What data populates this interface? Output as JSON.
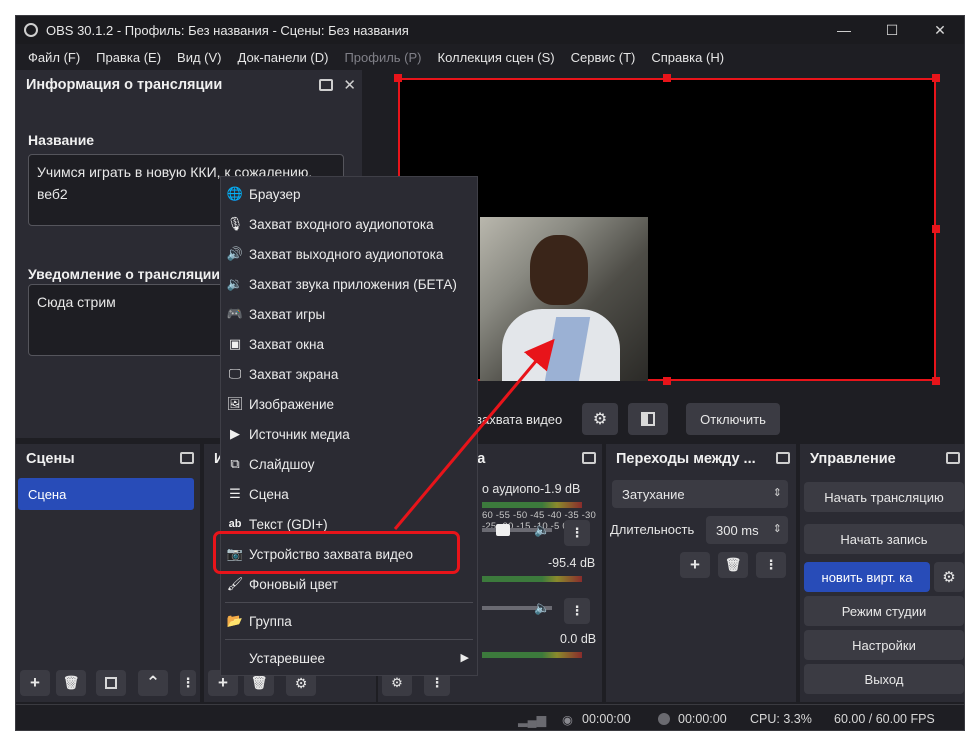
{
  "window": {
    "title": "OBS 30.1.2 - Профиль: Без названия - Сцены: Без названия",
    "minimize": "—",
    "maximize": "☐",
    "close": "✕"
  },
  "menu": [
    {
      "label": "Файл (F)",
      "enabled": true
    },
    {
      "label": "Правка (E)",
      "enabled": true
    },
    {
      "label": "Вид (V)",
      "enabled": true
    },
    {
      "label": "Док-панели (D)",
      "enabled": true
    },
    {
      "label": "Профиль (P)",
      "enabled": false
    },
    {
      "label": "Коллекция сцен (S)",
      "enabled": true
    },
    {
      "label": "Сервис (T)",
      "enabled": true
    },
    {
      "label": "Справка (H)",
      "enabled": true
    }
  ],
  "info_dock": {
    "title": "Информация о трансляции",
    "name_label": "Название",
    "name_value": "Учимся играть в новую ККИ, к сожалению, веб2",
    "notify_label": "Уведомление о трансляции",
    "notify_value": "Сюда стрим"
  },
  "preview_toolbar": {
    "source_name": "захвата видео",
    "disconnect": "Отключить"
  },
  "scenes": {
    "title": "Сцены",
    "items": [
      "Сцена"
    ]
  },
  "sources": {
    "title_partial": "И"
  },
  "mixer": {
    "title_partial": "ка",
    "channel1_name": "о аудиопо-1.9 dB",
    "channel2_db": "-95.4 dB",
    "channel3_db": "0.0 dB",
    "scale": "60 -55 -50 -45 -40 -35 -30 -25 -20 -15 -10 -5 0"
  },
  "transitions": {
    "title": "Переходы между ...",
    "selected": "Затухание",
    "duration_label": "Длительность",
    "duration_value": "300 ms"
  },
  "controls": {
    "title": "Управление",
    "start_stream": "Начать трансляцию",
    "start_record": "Начать запись",
    "virtual_cam": "новить вирт. ка",
    "studio_mode": "Режим студии",
    "settings": "Настройки",
    "exit": "Выход"
  },
  "status": {
    "stream_time": "00:00:00",
    "rec_time": "00:00:00",
    "cpu": "CPU: 3.3%",
    "fps": "60.00 / 60.00 FPS"
  },
  "context_menu": {
    "items": [
      {
        "label": "Браузер",
        "icon": "globe-icon"
      },
      {
        "label": "Захват входного аудиопотока",
        "icon": "microphone-icon"
      },
      {
        "label": "Захват выходного аудиопотока",
        "icon": "speaker-icon"
      },
      {
        "label": "Захват звука приложения (БЕТА)",
        "icon": "app-audio-icon"
      },
      {
        "label": "Захват игры",
        "icon": "gamepad-icon"
      },
      {
        "label": "Захват окна",
        "icon": "window-icon"
      },
      {
        "label": "Захват экрана",
        "icon": "monitor-icon"
      },
      {
        "label": "Изображение",
        "icon": "image-icon"
      },
      {
        "label": "Источник медиа",
        "icon": "play-icon"
      },
      {
        "label": "Слайдшоу",
        "icon": "slideshow-icon"
      },
      {
        "label": "Сцена",
        "icon": "list-icon"
      },
      {
        "label": "Текст (GDI+)",
        "icon": "text-icon"
      },
      {
        "label": "Устройство захвата видео",
        "icon": "camera-icon"
      },
      {
        "label": "Фоновый цвет",
        "icon": "brush-icon"
      },
      {
        "label": "Группа",
        "icon": "folder-icon"
      },
      {
        "label": "Устаревшее",
        "icon": "submenu-arrow-icon"
      }
    ]
  },
  "colors": {
    "accent_blue": "#284cb8",
    "highlight_red": "#e8141a",
    "panel": "#2b2b33",
    "background": "#1e1e23"
  }
}
